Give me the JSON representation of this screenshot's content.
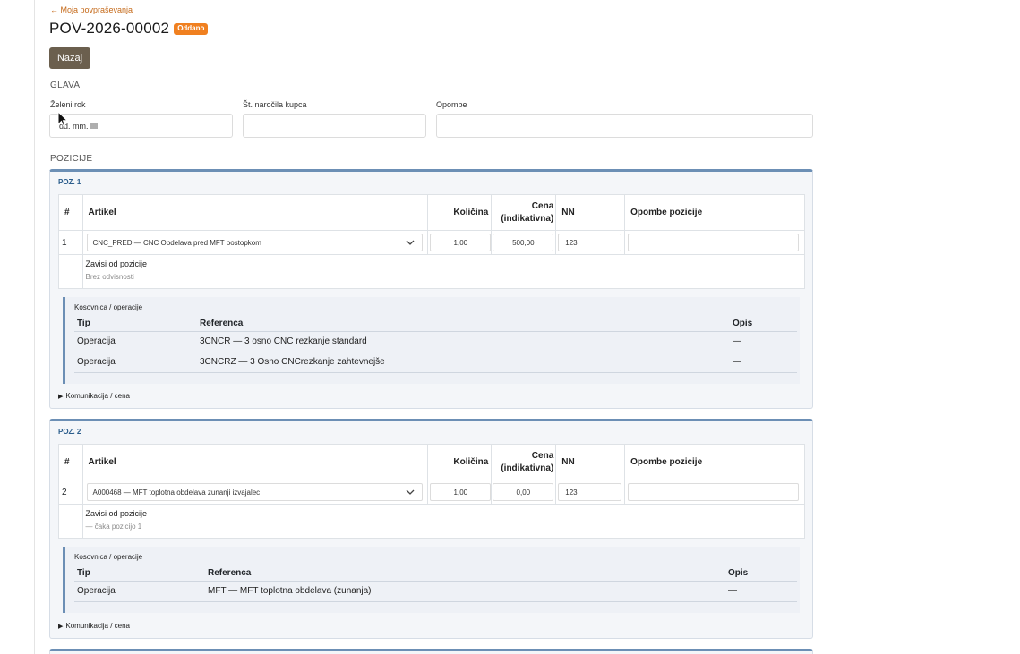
{
  "nav": {
    "back_link": "← Moja povpraševanja"
  },
  "header": {
    "title": "POV-2026-00002",
    "status": "Oddano",
    "back_button": "Nazaj"
  },
  "head_section": {
    "heading": "GLAVA",
    "fields": [
      {
        "label": "Želeni rok",
        "placeholder": "dd. mm. llll"
      },
      {
        "label": "Št. naročila kupca",
        "placeholder": ""
      },
      {
        "label": "Opombe",
        "placeholder": ""
      }
    ]
  },
  "positions_heading": "POZICIJE",
  "table_headers": {
    "num": "#",
    "article": "Artikel",
    "qty": "Količina",
    "price_a": "Cena",
    "price_b": "(indikativna)",
    "nn": "NN",
    "notes": "Opombe pozicije"
  },
  "dependency_label": "Zavisi od pozicije",
  "bom_title": "Kosovnica / operacije",
  "bom_headers": {
    "type": "Tip",
    "ref": "Referenca",
    "desc": "Opis"
  },
  "comm_label": "Komunikacija / cena",
  "positions": [
    {
      "title": "POZ. 1",
      "num": "1",
      "article": "CNC_PRED — CNC Obdelava pred MFT postopkom",
      "qty": "1,00",
      "price": "500,00",
      "nn": "123",
      "dependency": "Brez odvisnosti",
      "bom": [
        {
          "type": "Operacija",
          "ref": "3CNCR — 3 osno CNC rezkanje standard",
          "desc": "—"
        },
        {
          "type": "Operacija",
          "ref": "3CNCRZ — 3 Osno CNCrezkanje zahtevnejše",
          "desc": "—"
        }
      ]
    },
    {
      "title": "POZ. 2",
      "num": "2",
      "article": "A000468 — MFT toplotna obdelava zunanji izvajalec",
      "qty": "1,00",
      "price": "0,00",
      "nn": "123",
      "dependency": "— čaka pozicijo 1",
      "bom": [
        {
          "type": "Operacija",
          "ref": "MFT — MFT toplotna obdelava (zunanja)",
          "desc": "—"
        }
      ]
    }
  ],
  "colors": {
    "accent": "#6c8fb5",
    "badge": "#f08020",
    "button": "#6b5f4e",
    "link": "#c56a1a"
  }
}
